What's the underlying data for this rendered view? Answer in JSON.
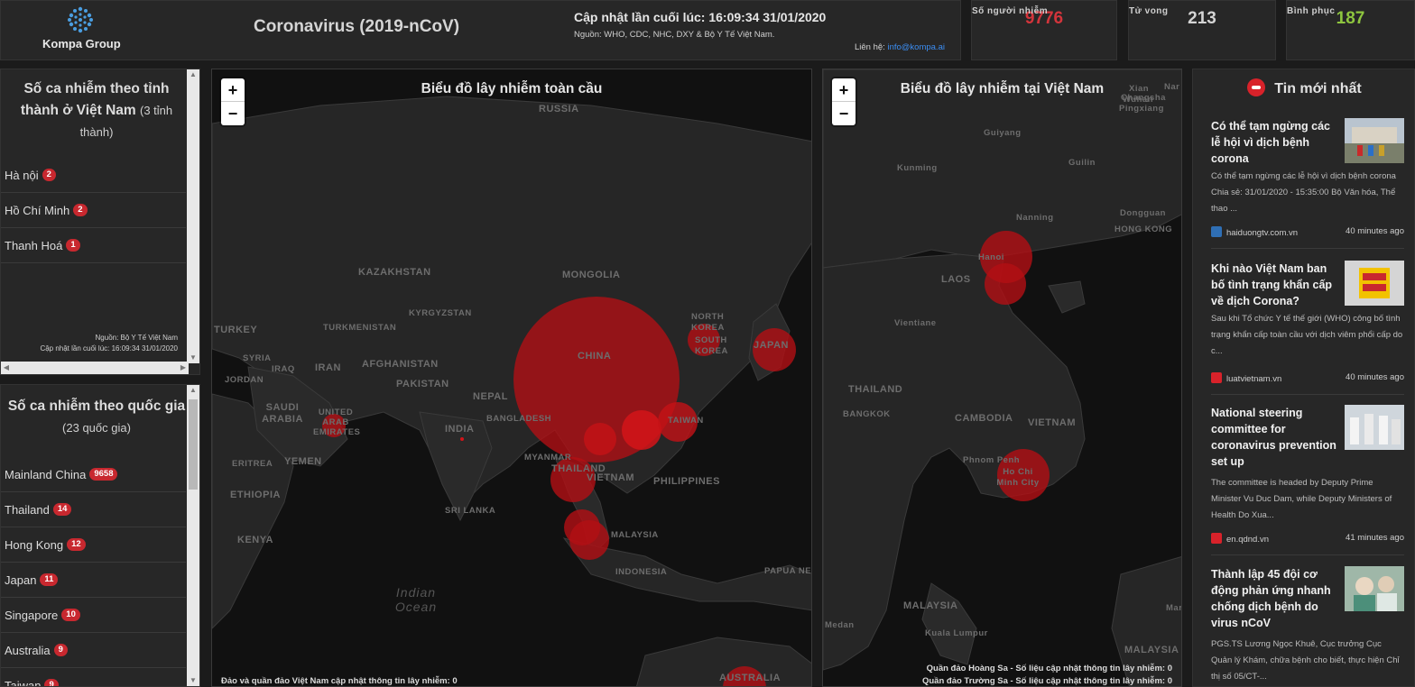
{
  "header": {
    "logo_text": "Kompa Group",
    "title": "Coronavirus (2019-nCoV)",
    "update": "Cập nhật lần cuối lúc: 16:09:34 31/01/2020",
    "sources": "Nguồn: WHO, CDC, NHC, DXY & Bộ Y Tế Việt Nam.",
    "contact_label": "Liên hệ:",
    "contact_email": "info@kompa.ai"
  },
  "stats": [
    {
      "label": "Số người nhiễm",
      "value": "9776",
      "color": "#d3343b"
    },
    {
      "label": "Tử vong",
      "value": "213",
      "color": "#d4d4d4"
    },
    {
      "label": "Bình phục",
      "value": "187",
      "color": "#8ec63f"
    }
  ],
  "vn_panel": {
    "title": "Số ca nhiễm theo tỉnh thành ở Việt Nam",
    "subtitle": "(3 tỉnh thành)",
    "items": [
      {
        "name": "Hà nội",
        "count": "2"
      },
      {
        "name": "Hồ Chí Minh",
        "count": "2"
      },
      {
        "name": "Thanh Hoá",
        "count": "1"
      }
    ],
    "source": "Nguồn: Bộ Y Tế Việt Nam",
    "updated": "Cập nhật lần cuối lúc: 16:09:34 31/01/2020"
  },
  "world_panel": {
    "title": "Số ca nhiễm theo quốc gia",
    "subtitle": "(23 quốc gia)",
    "items": [
      {
        "name": "Mainland China",
        "count": "9658"
      },
      {
        "name": "Thailand",
        "count": "14"
      },
      {
        "name": "Hong Kong",
        "count": "12"
      },
      {
        "name": "Japan",
        "count": "11"
      },
      {
        "name": "Singapore",
        "count": "10"
      },
      {
        "name": "Australia",
        "count": "9"
      },
      {
        "name": "Taiwan",
        "count": "9"
      }
    ]
  },
  "world_map": {
    "title": "Biểu đồ lây nhiễm toàn cầu",
    "zoom_in": "+",
    "zoom_out": "−",
    "footer": "Đảo và quần đảo Việt Nam cập nhật thông tin lây nhiễm: 0",
    "labels": [
      "RUSSIA",
      "KAZAKHSTAN",
      "MONGOLIA",
      "KYRGYZSTAN",
      "TURKMENISTAN",
      "TURKEY",
      "SYRIA",
      "IRAQ",
      "IRAN",
      "JORDAN",
      "AFGHANISTAN",
      "PAKISTAN",
      "NEPAL",
      "CHINA",
      "NORTH KOREA",
      "SOUTH KOREA",
      "JAPAN",
      "SAUDI ARABIA",
      "UNITED ARAB EMIRATES",
      "INDIA",
      "BANGLADESH",
      "MYANMAR",
      "THAILAND",
      "VIETNAM",
      "TAIWAN",
      "PHILIPPINES",
      "ERITREA",
      "YEMEN",
      "ETHIOPIA",
      "SRI LANKA",
      "KENYA",
      "MALAYSIA",
      "INDONESIA",
      "PAPUA NEW",
      "Indian Ocean",
      "AUSTRALIA"
    ]
  },
  "vn_map": {
    "title": "Biểu đồ lây nhiễm tại Việt Nam",
    "zoom_in": "+",
    "zoom_out": "−",
    "footer1": "Quần đảo Hoàng Sa - Số liệu cập nhật thông tin lây nhiễm: 0",
    "footer2": "Quần đảo Trường Sa - Số liệu cập nhật thông tin lây nhiễm: 0",
    "labels": [
      "Nar",
      "Xian",
      "Wuhan",
      "Pingxiang",
      "Guiyang",
      "Kunming",
      "Guilin",
      "Changsha",
      "Nanning",
      "Dongguan",
      "HONG KONG",
      "Hanoi",
      "LAOS",
      "Vientiane",
      "THAILAND",
      "BANGKOK",
      "CAMBODIA",
      "VIETNAM",
      "Phnom Penh",
      "Ho Chi Minh City",
      "MALAYSIA",
      "Medan",
      "Kuala Lumpur",
      "MALAYSIA",
      "Mar"
    ]
  },
  "news": {
    "title": "Tin mới nhất",
    "items": [
      {
        "title": "Có thể tạm ngừng các lễ hội vì dịch bệnh corona",
        "desc": "Có thể tạm ngừng các lễ hội vì dịch bệnh corona Chia sẻ: 31/01/2020 - 15:35:00 Bộ Văn hóa, Thể thao ...",
        "source": "haiduongtv.com.vn",
        "time": "40 minutes ago",
        "fav_color": "#2f6fb5"
      },
      {
        "title": "Khi nào Việt Nam ban bố tình trạng khẩn cấp về dịch Corona?",
        "desc": "Sau khi Tổ chức Y tế thế giới (WHO) công bố tình trạng khẩn cấp toàn cầu với dịch viêm phổi cấp do c...",
        "source": "luatvietnam.vn",
        "time": "40 minutes ago",
        "fav_color": "#d8222a"
      },
      {
        "title": "National steering committee for coronavirus prevention set up",
        "desc": "The committee is headed by Deputy Prime Minister Vu Duc Dam, while Deputy Ministers of Health Do Xua...",
        "source": "en.qdnd.vn",
        "time": "41 minutes ago",
        "fav_color": "#d8222a"
      },
      {
        "title": "Thành lập 45 đội cơ động phản ứng nhanh chống dịch bệnh do virus nCoV",
        "desc": "PGS.TS Lương Ngọc Khuê, Cục trưởng Cục Quản lý Khám, chữa bệnh cho biết, thực hiện Chỉ thị số 05/CT-...",
        "source": "",
        "time": "",
        "fav_color": "#2f6fb5"
      }
    ]
  }
}
